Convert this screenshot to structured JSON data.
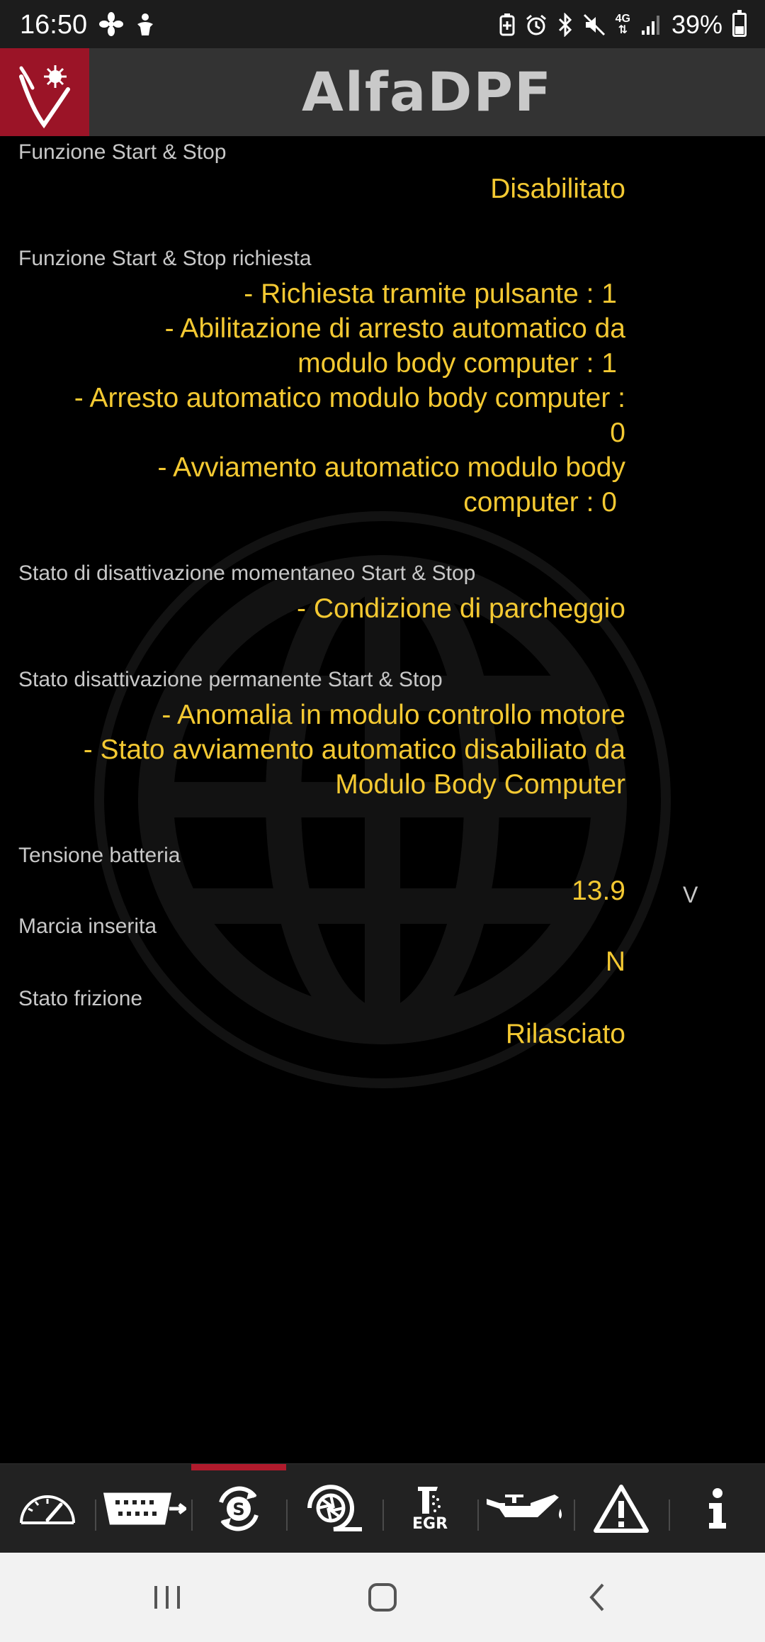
{
  "status_bar": {
    "time": "16:50",
    "left_icons": [
      "fan-icon",
      "accessibility-icon"
    ],
    "right_icons": [
      "battery-saver-icon",
      "alarm-icon",
      "bluetooth-icon",
      "mute-icon",
      "4g-icon",
      "signal-icon"
    ],
    "network": "4G",
    "battery_percent": "39%",
    "battery_level": 0.39
  },
  "app": {
    "title": "AlfaDPF",
    "brand_color": "#9b1427",
    "header_color": "#333333"
  },
  "fields": [
    {
      "label": "Funzione Start & Stop",
      "value": "Disabilitato"
    },
    {
      "label": "Funzione Start & Stop richiesta",
      "lines": [
        "- Richiesta tramite pulsante : 1",
        "- Abilitazione di arresto automatico da",
        "modulo body computer : 1",
        "- Arresto automatico modulo body computer :",
        "0",
        "- Avviamento automatico modulo body",
        "computer : 0"
      ]
    },
    {
      "label": "Stato di disattivazione momentaneo Start & Stop",
      "value": "- Condizione di parcheggio"
    },
    {
      "label": "Stato disattivazione permanente Start & Stop",
      "lines": [
        "- Anomalia in modulo controllo motore",
        "- Stato avviamento automatico disabiliato da",
        "Modulo Body Computer"
      ]
    },
    {
      "label": "Tensione batteria",
      "value": "13.9",
      "unit": "V"
    },
    {
      "label": "Marcia inserita",
      "value": "N"
    },
    {
      "label": "Stato frizione",
      "value": "Rilasciato"
    }
  ],
  "tabs": [
    {
      "name": "dashboard",
      "icon": "gauge-icon"
    },
    {
      "name": "obd",
      "icon": "obd-connector-icon"
    },
    {
      "name": "start-stop",
      "icon": "start-stop-icon",
      "active": true
    },
    {
      "name": "turbo",
      "icon": "turbo-icon"
    },
    {
      "name": "egr",
      "icon": "egr-icon",
      "text": "EGR"
    },
    {
      "name": "oil",
      "icon": "oil-can-icon"
    },
    {
      "name": "warnings",
      "icon": "warning-icon"
    },
    {
      "name": "info",
      "icon": "info-icon"
    }
  ],
  "colors": {
    "value_text": "#f4c932",
    "label_text": "#c8c8c8",
    "active_tab": "#b01a2c"
  }
}
